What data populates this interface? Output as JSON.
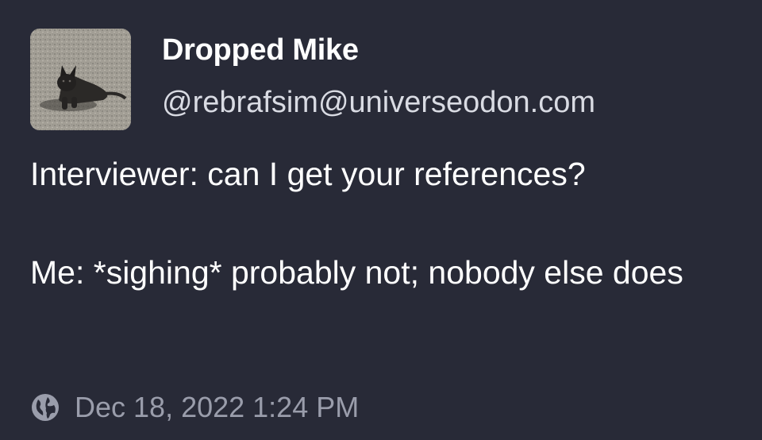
{
  "post": {
    "author": {
      "display_name": "Dropped Mike",
      "handle": "@rebrafsim@universeodon.com",
      "avatar_icon": "dog-photo-avatar"
    },
    "content": {
      "paragraph_1": "Interviewer: can I get your references?",
      "paragraph_2": "Me: *sighing* probably not; nobody else does"
    },
    "meta": {
      "visibility_icon": "globe-icon",
      "timestamp": "Dec 18, 2022 1:24 PM"
    }
  },
  "colors": {
    "background": "#282a37",
    "text_primary": "#ffffff",
    "text_secondary": "#d9dbe3",
    "text_muted": "#9a9dab"
  }
}
